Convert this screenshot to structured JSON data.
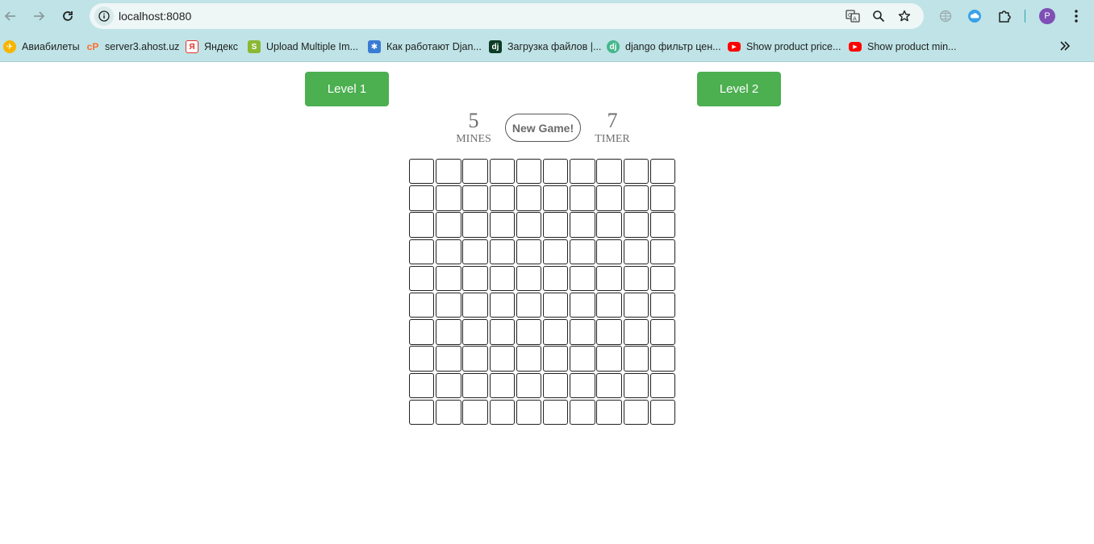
{
  "browser": {
    "url": "localhost:8080",
    "profile_initial": "P",
    "icons": [
      "back-icon",
      "forward-icon",
      "reload-icon",
      "site-info-icon",
      "translate-icon",
      "zoom-icon",
      "bookmark-star-icon",
      "globe-extension-icon",
      "cloud-extension-icon",
      "extensions-puzzle-icon",
      "profile-avatar",
      "menu-kebab-icon"
    ]
  },
  "bookmarks": [
    {
      "label": "Авиабилеты",
      "icon": "aviasales-icon",
      "color": "#f7b500"
    },
    {
      "label": "server3.ahost.uz",
      "icon": "cpanel-icon",
      "color": "#ff6c2c"
    },
    {
      "label": "Яндекс",
      "icon": "yandex-icon",
      "color": "#e5332a"
    },
    {
      "label": "Upload Multiple Im...",
      "icon": "s-site-icon",
      "color": "#8bb833"
    },
    {
      "label": "Как работают Djan...",
      "icon": "gear-site-icon",
      "color": "#3a7bd5"
    },
    {
      "label": "Загрузка файлов |...",
      "icon": "django-icon",
      "color": "#0c3c26"
    },
    {
      "label": "django фильтр цен...",
      "icon": "dj-green-icon",
      "color": "#44b78b"
    },
    {
      "label": "Show product price...",
      "icon": "youtube-icon",
      "color": "#ff0000"
    },
    {
      "label": "Show product min...",
      "icon": "youtube-icon",
      "color": "#ff0000"
    }
  ],
  "game": {
    "level1_label": "Level 1",
    "level2_label": "Level 2",
    "mines_count": "5",
    "mines_label": "MINES",
    "new_game_label": "New Game!",
    "timer_value": "7",
    "timer_label": "TIMER",
    "rows": 10,
    "cols": 10
  },
  "colors": {
    "accent_green": "#4caf50",
    "browser_chrome": "#bfe3e6"
  }
}
